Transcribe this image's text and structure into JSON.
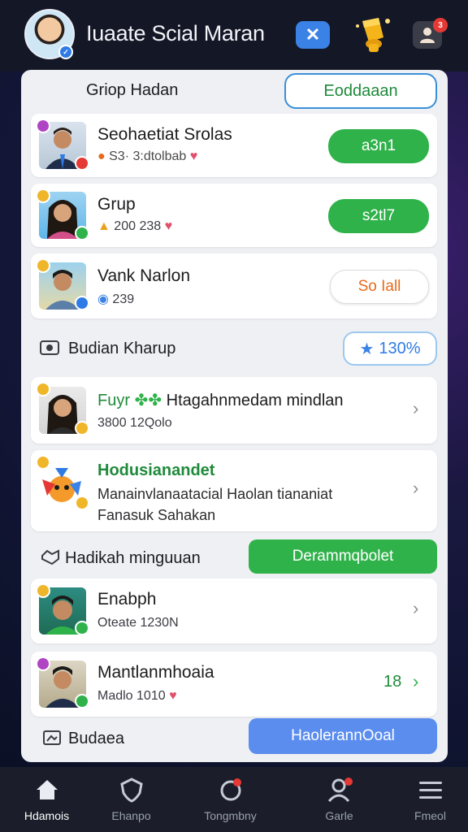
{
  "header": {
    "title": "Iuaate Scial Maran",
    "close_icon": "close-icon",
    "trophy_icon": "trophy-icon",
    "notifications": {
      "icon": "user-notification-icon",
      "count": "3"
    }
  },
  "section_top": {
    "title": "Griop Hadan",
    "action": "Eoddaaan"
  },
  "cards_top": [
    {
      "name": "Seohaetiat Srolas",
      "meta": "S3· 3:dtolbab",
      "button": "a3n1",
      "button_style": "green"
    },
    {
      "name": "Grup",
      "meta": "200 238",
      "button": "s2tl7",
      "button_style": "green"
    },
    {
      "name": "Vank Narlon",
      "meta": "239",
      "button": "So Iall",
      "button_style": "white"
    }
  ],
  "section_mid": {
    "title": "Budian Kharup",
    "badge": "130%"
  },
  "cards_mid": [
    {
      "title": "Fuyr",
      "title_rest": "Htagahnmedam mindlan",
      "meta": "3800 12Qolo"
    },
    {
      "title": "Hodusianandet",
      "line2": "Manainvlanaatacial Haolan tiananiat",
      "line3": "Fanasuk Sahakan"
    }
  ],
  "section_low": {
    "title": "Hadikah minguuan",
    "action": "Derammqbolet"
  },
  "cards_low": [
    {
      "name": "Enabph",
      "meta": "Oteate 1230N"
    },
    {
      "name": "Mantlanmhoaia",
      "meta": "Madlo 1010",
      "value": "18"
    }
  ],
  "section_bottom": {
    "title": "Budaea",
    "action": "HaolerannOoal"
  },
  "nav": [
    {
      "label": "Hdamois",
      "icon": "home-icon",
      "active": true
    },
    {
      "label": "Ehanpo",
      "icon": "shield-icon",
      "active": false
    },
    {
      "label": "Tongmbny",
      "icon": "refresh-icon",
      "active": false
    },
    {
      "label": "Garle",
      "icon": "profile-icon",
      "active": false
    },
    {
      "label": "Fmeol",
      "icon": "menu-icon",
      "active": false
    }
  ],
  "colors": {
    "accent_green": "#2fb24a",
    "accent_blue": "#3b82e6",
    "accent_orange": "#e86a1c",
    "topbar": "#141826",
    "nav": "#1b1e2a"
  }
}
